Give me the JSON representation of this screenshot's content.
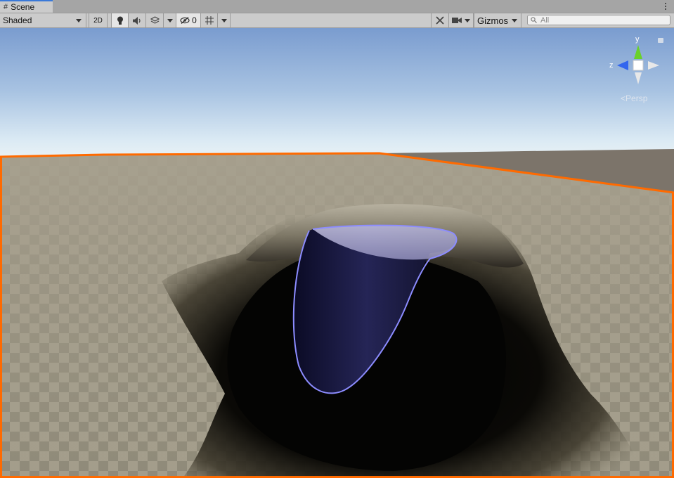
{
  "window": {
    "tab_label": "Scene",
    "tab_icon": "hash-icon"
  },
  "toolbar": {
    "shading_mode": "Shaded",
    "mode_2d_label": "2D",
    "lighting_icon": "bulb-icon",
    "audio_icon": "speaker-icon",
    "effects_icon": "layers-icon",
    "hidden_count": "0",
    "grid_icon": "grid-icon",
    "tools_icon": "tools-icon",
    "camera_icon": "camera-icon",
    "gizmos_label": "Gizmos",
    "search_placeholder": "All"
  },
  "scene_gizmo": {
    "y_label": "y",
    "z_label": "z",
    "projection_label": "Persp"
  },
  "colors": {
    "accent": "#3a79d8",
    "selection_outline": "#ff6a00",
    "collider_outline": "#8c8cff",
    "gizmo_y": "#6ad12a",
    "gizmo_z": "#3366ee"
  }
}
